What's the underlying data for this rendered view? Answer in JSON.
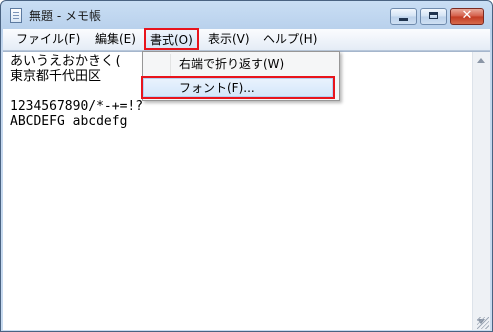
{
  "window": {
    "title": "無題 - メモ帳"
  },
  "title_buttons": {
    "minimize": "minimize-icon",
    "maximize": "maximize-icon",
    "close": "✕"
  },
  "menu": {
    "file": "ファイル(F)",
    "edit": "編集(E)",
    "format": "書式(O)",
    "view": "表示(V)",
    "help": "ヘルプ(H)"
  },
  "format_menu": {
    "word_wrap": "右端で折り返す(W)",
    "font": "フォント(F)..."
  },
  "document": {
    "lines": [
      "あいうえおかきく(",
      "東京都千代田区",
      "",
      "1234567890/*-+=!?",
      "ABCDEFG abcdefg"
    ]
  },
  "highlight_color": "#e8141c"
}
